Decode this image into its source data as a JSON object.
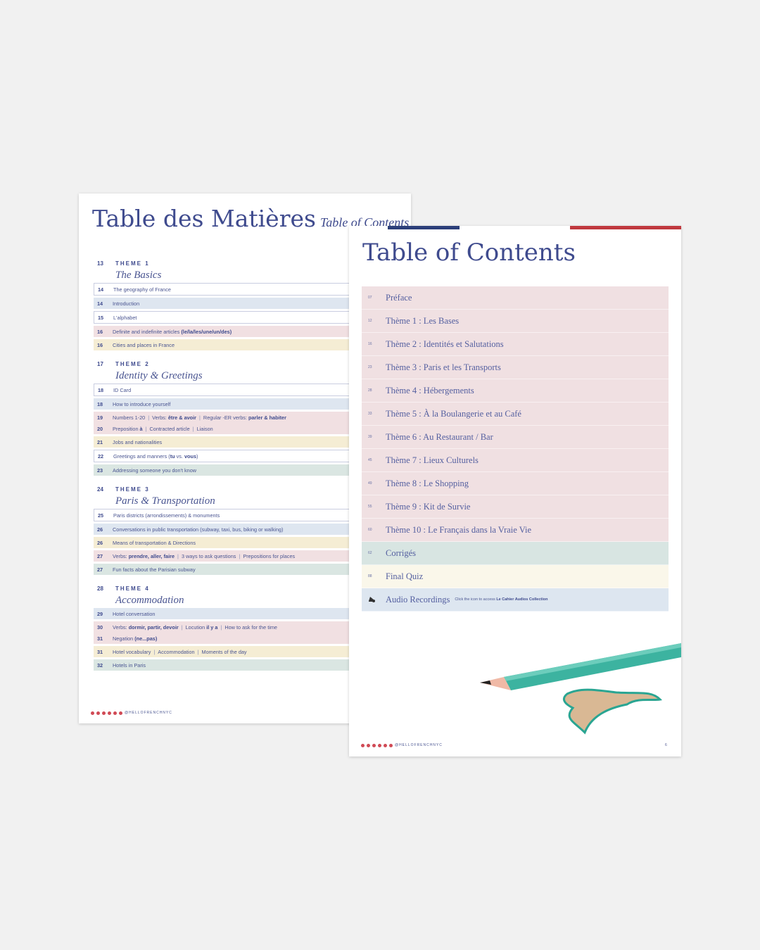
{
  "left_page": {
    "title": "Table des Matières",
    "subtitle": "Table of Contents",
    "themes": [
      {
        "page": "13",
        "label": "THEME 1",
        "title": "The Basics",
        "rows": [
          {
            "color": "white",
            "lines": [
              {
                "page": "14",
                "segments": [
                  {
                    "t": "The geography of France"
                  }
                ]
              }
            ]
          },
          {
            "color": "blue",
            "lines": [
              {
                "page": "14",
                "segments": [
                  {
                    "t": "Introduction"
                  }
                ]
              }
            ]
          },
          {
            "color": "white",
            "lines": [
              {
                "page": "15",
                "segments": [
                  {
                    "t": "L'alphabet"
                  }
                ]
              }
            ]
          },
          {
            "color": "pink",
            "lines": [
              {
                "page": "16",
                "segments": [
                  {
                    "t": "Definite and indefinite articles "
                  },
                  {
                    "t": "(le/la/les/une/un/des)",
                    "b": true
                  }
                ]
              }
            ]
          },
          {
            "color": "yellow",
            "lines": [
              {
                "page": "16",
                "segments": [
                  {
                    "t": "Cities and places in France"
                  }
                ]
              }
            ]
          }
        ]
      },
      {
        "page": "17",
        "label": "THEME 2",
        "title": "Identity & Greetings",
        "rows": [
          {
            "color": "white",
            "lines": [
              {
                "page": "18",
                "segments": [
                  {
                    "t": "ID Card"
                  }
                ]
              }
            ]
          },
          {
            "color": "blue",
            "lines": [
              {
                "page": "18",
                "segments": [
                  {
                    "t": "How to introduce yourself"
                  }
                ]
              }
            ]
          },
          {
            "color": "pink",
            "lines": [
              {
                "page": "19",
                "segments": [
                  {
                    "t": "Numbers 1-20"
                  },
                  {
                    "sep": "|"
                  },
                  {
                    "t": "Verbs: "
                  },
                  {
                    "t": "être & avoir",
                    "b": true
                  },
                  {
                    "sep": "|"
                  },
                  {
                    "t": "Regular -ER verbs: "
                  },
                  {
                    "t": "parler & habiter",
                    "b": true
                  }
                ]
              },
              {
                "page": "20",
                "segments": [
                  {
                    "t": "Preposition "
                  },
                  {
                    "t": "à",
                    "b": true
                  },
                  {
                    "sep": "|"
                  },
                  {
                    "t": "Contracted article"
                  },
                  {
                    "sep": "|"
                  },
                  {
                    "t": "Liaison"
                  }
                ]
              }
            ]
          },
          {
            "color": "yellow",
            "lines": [
              {
                "page": "21",
                "segments": [
                  {
                    "t": "Jobs and nationalities"
                  }
                ]
              }
            ]
          },
          {
            "color": "white",
            "lines": [
              {
                "page": "22",
                "segments": [
                  {
                    "t": "Greetings and manners ("
                  },
                  {
                    "t": "tu",
                    "b": true
                  },
                  {
                    "t": " vs. "
                  },
                  {
                    "t": "vous",
                    "b": true
                  },
                  {
                    "t": ")"
                  }
                ]
              }
            ]
          },
          {
            "color": "green",
            "lines": [
              {
                "page": "23",
                "segments": [
                  {
                    "t": "Addressing someone you don't know"
                  }
                ]
              }
            ]
          }
        ]
      },
      {
        "page": "24",
        "label": "THEME 3",
        "title": "Paris & Transportation",
        "rows": [
          {
            "color": "white",
            "lines": [
              {
                "page": "25",
                "segments": [
                  {
                    "t": "Paris districts (arrondissements) & monuments"
                  }
                ]
              }
            ]
          },
          {
            "color": "blue",
            "lines": [
              {
                "page": "26",
                "segments": [
                  {
                    "t": "Conversations in public transportation (subway, taxi, bus, biking or walking)"
                  }
                ]
              }
            ]
          },
          {
            "color": "yellow",
            "lines": [
              {
                "page": "26",
                "segments": [
                  {
                    "t": "Means of transportation & Directions"
                  }
                ]
              }
            ]
          },
          {
            "color": "pink",
            "lines": [
              {
                "page": "27",
                "segments": [
                  {
                    "t": "Verbs: "
                  },
                  {
                    "t": "prendre, aller, faire",
                    "b": true
                  },
                  {
                    "sep": "|"
                  },
                  {
                    "t": "3 ways to ask questions"
                  },
                  {
                    "sep": "|"
                  },
                  {
                    "t": "Prepositions for places"
                  }
                ]
              }
            ]
          },
          {
            "color": "green",
            "lines": [
              {
                "page": "27",
                "segments": [
                  {
                    "t": "Fun facts about the Parisian subway"
                  }
                ]
              }
            ]
          }
        ]
      },
      {
        "page": "28",
        "label": "THEME 4",
        "title": "Accommodation",
        "rows": [
          {
            "color": "blue",
            "lines": [
              {
                "page": "29",
                "segments": [
                  {
                    "t": "Hotel conversation"
                  }
                ]
              }
            ]
          },
          {
            "color": "pink",
            "lines": [
              {
                "page": "30",
                "segments": [
                  {
                    "t": "Verbs: "
                  },
                  {
                    "t": "dormir, partir, devoir",
                    "b": true
                  },
                  {
                    "sep": "|"
                  },
                  {
                    "t": "Locution "
                  },
                  {
                    "t": "il y a",
                    "b": true
                  },
                  {
                    "sep": "|"
                  },
                  {
                    "t": "How to ask for the time"
                  }
                ]
              },
              {
                "page": "31",
                "segments": [
                  {
                    "t": "Negation "
                  },
                  {
                    "t": "(ne...pas)",
                    "b": true
                  }
                ]
              }
            ]
          },
          {
            "color": "yellow",
            "lines": [
              {
                "page": "31",
                "segments": [
                  {
                    "t": "Hotel vocabulary"
                  },
                  {
                    "sep": "|"
                  },
                  {
                    "t": "Accommodation"
                  },
                  {
                    "sep": "|"
                  },
                  {
                    "t": "Moments of the day"
                  }
                ]
              }
            ]
          },
          {
            "color": "green",
            "lines": [
              {
                "page": "32",
                "segments": [
                  {
                    "t": "Hotels in Paris"
                  }
                ]
              }
            ]
          }
        ]
      }
    ],
    "footer_handle": "@HELLOFRENCHNYC"
  },
  "right_page": {
    "title": "Table of Contents",
    "rows": [
      {
        "page": "07",
        "label": "Préface",
        "color": "pink"
      },
      {
        "page": "12",
        "label": "Thème 1 : Les Bases",
        "color": "pink"
      },
      {
        "page": "16",
        "label": "Thème 2 : Identités et Salutations",
        "color": "pink"
      },
      {
        "page": "23",
        "label": "Thème 3 : Paris et les Transports",
        "color": "pink"
      },
      {
        "page": "28",
        "label": "Thème 4 : Hébergements",
        "color": "pink"
      },
      {
        "page": "33",
        "label": "Thème 5 : À la Boulangerie et au Café",
        "color": "pink"
      },
      {
        "page": "39",
        "label": "Thème 6 : Au Restaurant / Bar",
        "color": "pink"
      },
      {
        "page": "45",
        "label": "Thème 7 : Lieux Culturels",
        "color": "pink"
      },
      {
        "page": "49",
        "label": "Thème 8 : Le Shopping",
        "color": "pink"
      },
      {
        "page": "55",
        "label": "Thème 9 : Kit de Survie",
        "color": "pink"
      },
      {
        "page": "60",
        "label": "Thème 10 : Le Français dans la Vraie Vie",
        "color": "pink"
      },
      {
        "page": "62",
        "label": "Corrigés",
        "color": "green"
      },
      {
        "page": "88",
        "label": "Final Quiz",
        "color": "cream"
      }
    ],
    "audio": {
      "label": "Audio Recordings",
      "note": "Click the icon to access ",
      "note_bold": "Le Cahier Audios Collection",
      "icon": "headphones-icon"
    },
    "footer_handle": "@HELLOFRENCHNYC",
    "page_number": "6"
  },
  "colors": {
    "navy": "#2c3f7a",
    "red": "#c0393f",
    "text": "#4a5591"
  }
}
